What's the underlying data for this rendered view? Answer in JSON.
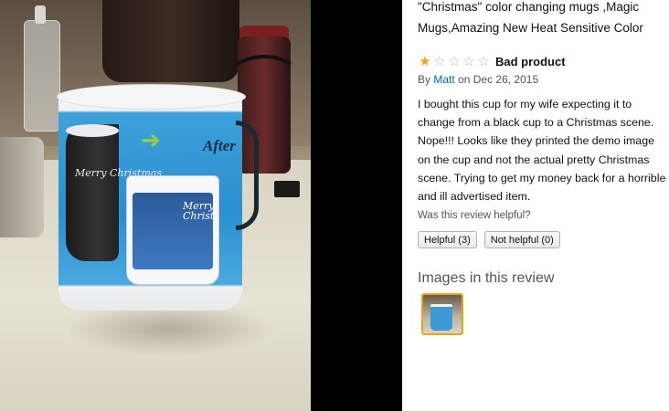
{
  "product": {
    "title_line1": "\"Christmas\" color changing mugs ,Magic",
    "title_line2": "Mugs,Amazing New Heat Sensitive Color"
  },
  "review": {
    "stars": {
      "rating": 1,
      "max": 5,
      "filled_color": "#f4a11d",
      "empty_color": "#b7b7b7",
      "icon": "star-icon"
    },
    "title": "Bad product",
    "byline": {
      "prefix": "By",
      "author": "Matt",
      "date_text": "on Dec 26, 2015"
    },
    "body": "I bought this cup for my wife expecting it to change from a black cup to a Christmas scene. Nope!!! Looks like they printed the demo image on the cup and not the actual pretty Christmas scene. Trying to get my money back for a horrible and ill advertised item.",
    "helpful_question": "Was this review helpful?",
    "helpful_button": "Helpful (3)",
    "not_helpful_button": "Not helpful (0)"
  },
  "images_section": {
    "heading": "Images in this review",
    "selected_border_color": "#e8a21c"
  },
  "photo": {
    "mug_text": {
      "after": "After",
      "script_left": "Merry Christmas",
      "script_right": "Merry Christ"
    }
  },
  "colors": {
    "link": "#0066c0",
    "star_filled": "#f4a11d",
    "mug_blue": "#2b8fd0"
  }
}
